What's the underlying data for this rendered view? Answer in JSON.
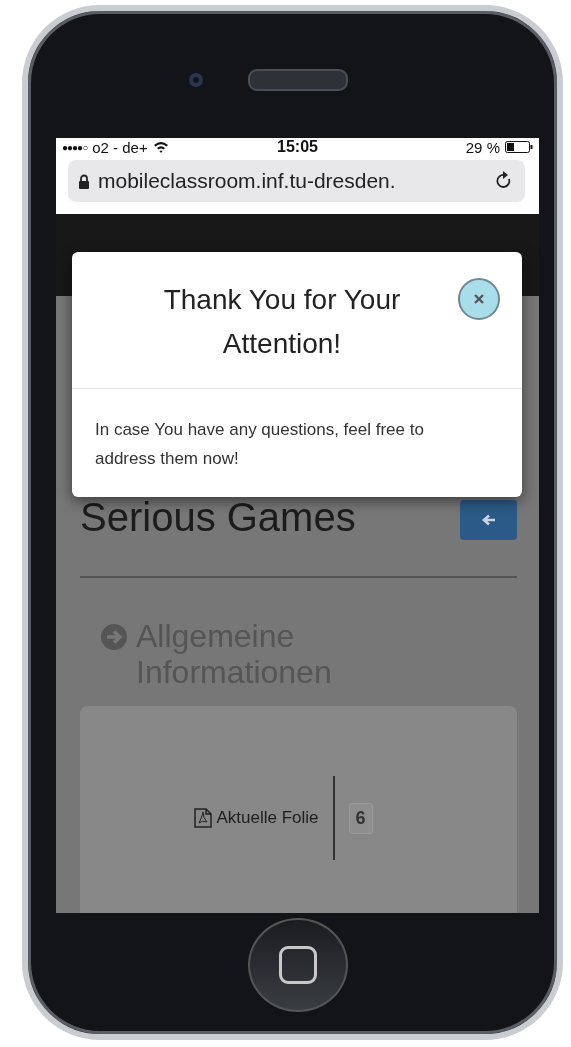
{
  "status_bar": {
    "signal": "●●●●○",
    "carrier": "o2 - de+",
    "time": "15:05",
    "battery": "29 %"
  },
  "address_bar": {
    "url": "mobileclassroom.inf.tu-dresden."
  },
  "page": {
    "title": "Serious Games",
    "section_heading": "Allgemeine Informationen",
    "slide": {
      "label": "Aktuelle Folie",
      "number": "6"
    }
  },
  "modal": {
    "title": "Thank You for Your Attention!",
    "message": "In case You have any questions, feel free to address them now!"
  }
}
